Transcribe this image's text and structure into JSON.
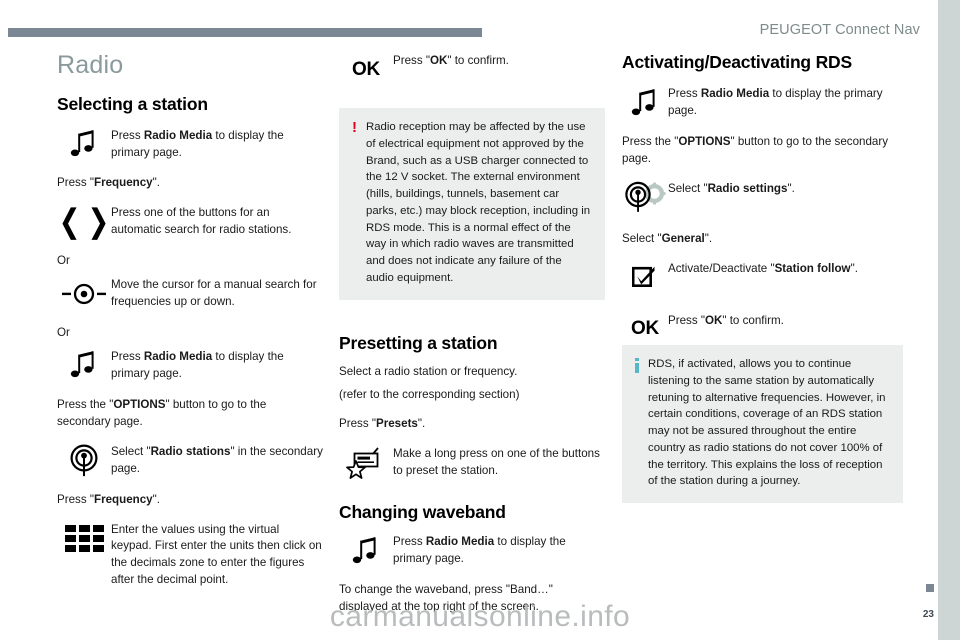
{
  "header": {
    "brand": "PEUGEOT Connect Nav"
  },
  "chapter": {
    "title": "Radio"
  },
  "col1": {
    "section_title": "Selecting a station",
    "row_radio_media": {
      "icon": "music-note-icon",
      "text_pre": "Press ",
      "text_bold": "Radio Media",
      "text_post": " to display the primary page."
    },
    "press_frequency_1": {
      "pre": "Press \"",
      "bold": "Frequency",
      "post": "\"."
    },
    "row_arrows": {
      "icon": "left-right-arrows-icon",
      "text": "Press one of the buttons for an automatic search for radio stations."
    },
    "or_1": "Or",
    "row_cursor": {
      "icon": "cursor-knob-icon",
      "text": "Move the cursor for a manual search for frequencies up or down."
    },
    "or_2": "Or",
    "row_radio_media_2": {
      "icon": "music-note-icon",
      "text_pre": "Press ",
      "text_bold": "Radio Media",
      "text_post": " to display the primary page."
    },
    "press_options": {
      "pre": "Press the \"",
      "bold": "OPTIONS",
      "post": "\" button to go to the secondary page."
    },
    "row_radio_stations": {
      "icon": "broadcast-antenna-icon",
      "pre": "Select \"",
      "bold": "Radio stations",
      "post": "\" in the secondary page."
    },
    "press_frequency_2": {
      "pre": "Press \"",
      "bold": "Frequency",
      "post": "\"."
    },
    "row_keypad": {
      "icon": "virtual-keypad-icon",
      "text": "Enter the values using the virtual keypad. First enter the units then click on the decimals zone to enter the figures after the decimal point."
    }
  },
  "col2": {
    "row_ok": {
      "icon": "ok-button-icon",
      "icon_label": "OK",
      "pre": "Press \"",
      "bold": "OK",
      "post": "\" to confirm."
    },
    "warning": {
      "icon": "warning-exclamation-icon",
      "marker": "!",
      "text": "Radio reception may be affected by the use of electrical equipment not approved by the Brand, such as a USB charger connected to the 12 V socket. The external environment (hills, buildings, tunnels, basement car parks, etc.) may block reception, including in RDS mode. This is a normal effect of the way in which radio waves are transmitted and does not indicate any failure of the audio equipment."
    },
    "section_title": "Presetting a station",
    "intro_line1": "Select a radio station or frequency.",
    "intro_line2": "(refer to the corresponding section)",
    "press_presets": {
      "pre": "Press \"",
      "bold": "Presets",
      "post": "\"."
    },
    "row_preset": {
      "icon": "radio-preset-star-icon",
      "text": "Make a long press on one of the buttons to preset the station."
    },
    "section_title_2": "Changing waveband",
    "row_radio_media_3": {
      "icon": "music-note-icon",
      "text_pre": "Press ",
      "text_bold": "Radio Media",
      "text_post": " to display the primary page."
    },
    "waveband_text": "To change the waveband, press \"Band…\" displayed at the top right of the screen."
  },
  "col3": {
    "section_title": "Activating/Deactivating RDS",
    "row_radio_media": {
      "icon": "music-note-icon",
      "text_pre": "Press ",
      "text_bold": "Radio Media",
      "text_post": " to display the primary page."
    },
    "press_options": {
      "pre": "Press the \"",
      "bold": "OPTIONS",
      "post": "\" button to go to the secondary page."
    },
    "row_radio_settings": {
      "icon": "radio-settings-icon",
      "pre": "Select \"",
      "bold": "Radio settings",
      "post": "\"."
    },
    "select_general": {
      "pre": "Select \"",
      "bold": "General",
      "post": "\"."
    },
    "row_station_follow": {
      "icon": "checkbox-checked-icon",
      "pre": "Activate/Deactivate \"",
      "bold": "Station follow",
      "post": "\"."
    },
    "row_ok": {
      "icon": "ok-button-icon",
      "icon_label": "OK",
      "pre": "Press \"",
      "bold": "OK",
      "post": "\" to confirm."
    },
    "info": {
      "icon": "info-icon",
      "text": "RDS, if activated, allows you to continue listening to the same station by automatically retuning to alternative frequencies. However, in certain conditions, coverage of an RDS station may not be assured throughout the entire country as radio stations do not cover 100% of the territory. This explains the loss of reception of the station during a journey."
    }
  },
  "footer": {
    "watermark": "carmanualsonline.info",
    "page_number": "23"
  },
  "colors": {
    "header_rule": "#7b8894",
    "brand_text": "#7d8c8b",
    "chapter_title": "#8a9a9c",
    "edge_strip": "#cdd6d5",
    "note_background": "#eceeee",
    "warning_marker": "#e2001a",
    "info_marker": "#56b7c9",
    "watermark": "#b9bcbd"
  }
}
